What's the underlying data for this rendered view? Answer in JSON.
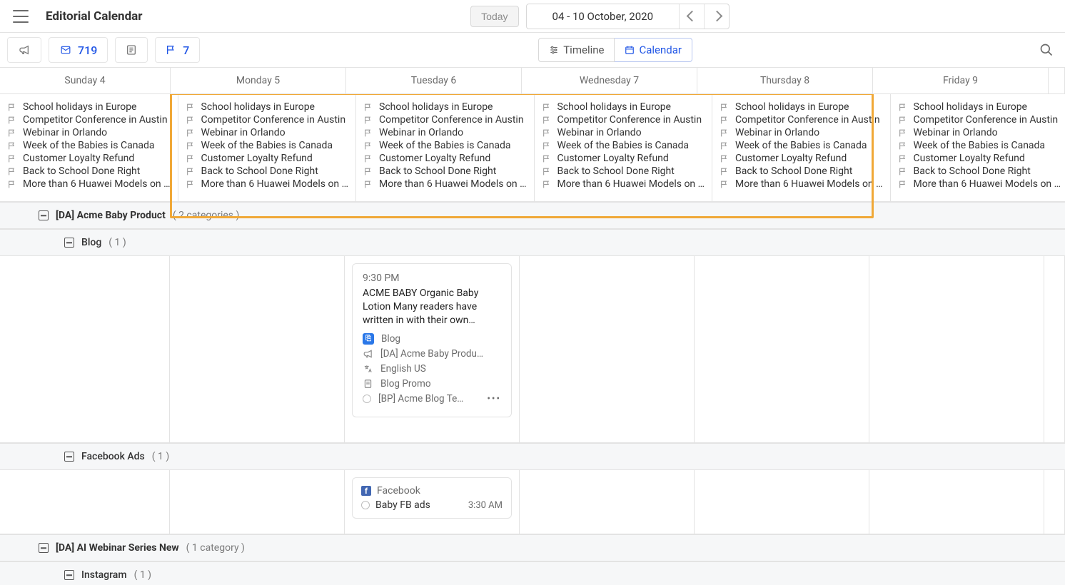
{
  "header": {
    "title": "Editorial Calendar",
    "today_label": "Today",
    "range_label": "04 - 10 October, 2020"
  },
  "toolbar": {
    "count_1": "719",
    "count_2": "7",
    "timeline_label": "Timeline",
    "calendar_label": "Calendar"
  },
  "days": [
    "Sunday 4",
    "Monday 5",
    "Tuesday 6",
    "Wednesday 7",
    "Thursday 8",
    "Friday 9"
  ],
  "flag_items": [
    "School holidays in Europe",
    "Competitor Conference in Austin",
    "Webinar in Orlando",
    "Week of the Babies is Canada",
    "Customer Loyalty Refund",
    "Back to School Done Right",
    "More than 6 Huawei Models on …"
  ],
  "groups": {
    "g1": {
      "name": "[DA] Acme Baby Product",
      "count_label": "( 2 categories )",
      "sub_blog": {
        "name": "Blog",
        "count_label": "( 1 )"
      },
      "sub_fb": {
        "name": "Facebook Ads",
        "count_label": "( 1 )"
      }
    },
    "g2": {
      "name": "[DA] AI Webinar Series New",
      "count_label": "( 1 category )",
      "sub_ig": {
        "name": "Instagram",
        "count_label": "( 1 )"
      }
    }
  },
  "blog_card": {
    "time": "9:30 PM",
    "title": "ACME BABY Organic Baby Lotion Many readers have written in with their own…",
    "meta": {
      "blog": "Blog",
      "campaign": "[DA] Acme Baby Produ…",
      "lang": "English US",
      "promo": "Blog Promo",
      "template": "[BP] Acme Blog Te…"
    }
  },
  "fb_card": {
    "network": "Facebook",
    "name": "Baby FB ads",
    "time": "3:30 AM"
  }
}
